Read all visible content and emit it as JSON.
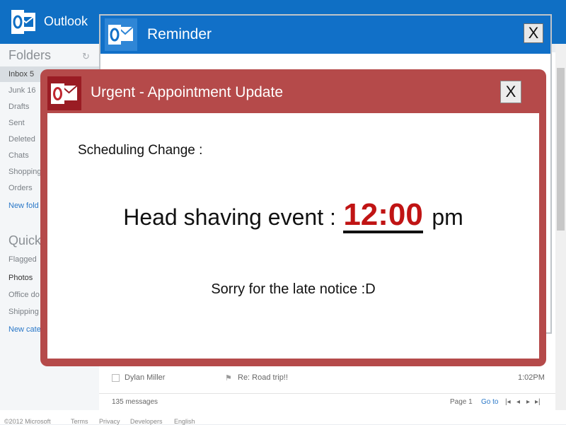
{
  "outlook": {
    "app_title": "Outlook",
    "folders_heading": "Folders",
    "folders": [
      {
        "label": "Inbox 5"
      },
      {
        "label": "Junk 16"
      },
      {
        "label": "Drafts"
      },
      {
        "label": "Sent"
      },
      {
        "label": "Deleted"
      },
      {
        "label": "Chats"
      },
      {
        "label": "Shopping"
      },
      {
        "label": "Orders"
      }
    ],
    "new_folder_link": "New fold",
    "quick_heading": "Quick",
    "quick_views": [
      {
        "label": "Flagged"
      },
      {
        "label": "Photos"
      },
      {
        "label": "Office do"
      },
      {
        "label": "Shipping"
      }
    ],
    "new_category_link": "New cate",
    "message_row": {
      "sender": "Dylan Miller",
      "subject": "Re: Road trip!!",
      "time": "1:02PM"
    },
    "message_count": "135 messages",
    "pager": {
      "page": "Page 1",
      "goto": "Go to"
    },
    "footer": [
      "©2012 Microsoft",
      "Terms",
      "Privacy",
      "Developers",
      "English"
    ]
  },
  "reminder": {
    "title": "Reminder",
    "close_label": "X"
  },
  "urgent": {
    "title": "Urgent - Appointment Update",
    "close_label": "X",
    "scheduling_label": "Scheduling Change :",
    "event_label": "Head shaving event :",
    "event_time": "12:00",
    "event_suffix": "pm",
    "apology": "Sorry for the late notice :D"
  },
  "colors": {
    "outlook_blue": "#0f6fc4",
    "urgent_red": "#b54a4a",
    "time_red": "#c01414"
  }
}
